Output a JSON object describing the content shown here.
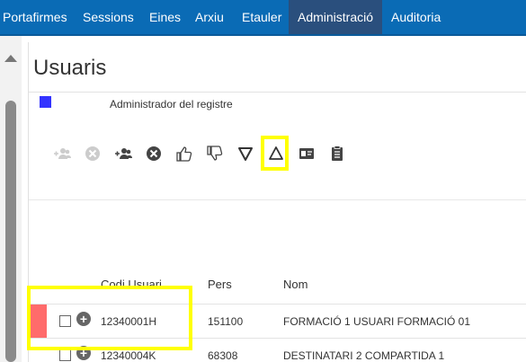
{
  "nav": {
    "items": [
      "Portafirmes",
      "Sessions",
      "Eines",
      "Arxiu",
      "Etauler",
      "Administració",
      "Auditoria"
    ],
    "active": "Administració"
  },
  "page": {
    "title": "Usuaris"
  },
  "legend": {
    "color": "#3333ff",
    "label": "Administrador del registre"
  },
  "toolbar": {
    "icons": [
      "add-users-disabled-icon",
      "remove-disabled-icon",
      "add-users-icon",
      "remove-icon",
      "thumbs-up-icon",
      "thumbs-down-icon",
      "triangle-down-icon",
      "triangle-up-icon",
      "contact-card-icon",
      "clipboard-icon"
    ],
    "highlighted": "triangle-up-icon"
  },
  "table": {
    "columns": [
      "Codi Usuari",
      "Pers",
      "Nom"
    ],
    "rows": [
      {
        "codi": "12340001H",
        "pers": "151100",
        "nom": "FORMACIÓ 1 USUARI FORMACIÓ 01",
        "row_color": "#ff6b6b"
      },
      {
        "codi": "12340004K",
        "pers": "68308",
        "nom": "DESTINATARI 2 COMPARTIDA 1"
      }
    ]
  }
}
